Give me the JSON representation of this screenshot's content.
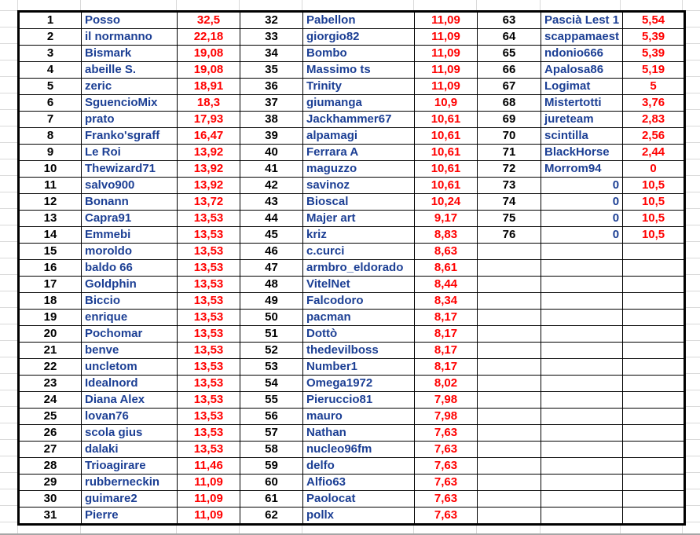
{
  "colors": {
    "name": "#1c3f94",
    "score": "#ff0000",
    "rank": "#000000"
  },
  "columns": [
    {
      "rows": [
        [
          "1",
          "Posso",
          "32,5"
        ],
        [
          "2",
          "il normanno",
          "22,18"
        ],
        [
          "3",
          "Bismark",
          "19,08"
        ],
        [
          "4",
          "abeille S.",
          "19,08"
        ],
        [
          "5",
          "zeric",
          "18,91"
        ],
        [
          "6",
          "SguencioMix",
          "18,3"
        ],
        [
          "7",
          "prato",
          "17,93"
        ],
        [
          "8",
          "Franko'sgraff",
          "16,47"
        ],
        [
          "9",
          "Le Roi",
          "13,92"
        ],
        [
          "10",
          "Thewizard71",
          "13,92"
        ],
        [
          "11",
          "salvo900",
          "13,92"
        ],
        [
          "12",
          "Bonann",
          "13,72"
        ],
        [
          "13",
          "Capra91",
          "13,53"
        ],
        [
          "14",
          "Emmebi",
          "13,53"
        ],
        [
          "15",
          "moroldo",
          "13,53"
        ],
        [
          "16",
          "baldo 66",
          "13,53"
        ],
        [
          "17",
          "Goldphin",
          "13,53"
        ],
        [
          "18",
          "Biccio",
          "13,53"
        ],
        [
          "19",
          "enrique",
          "13,53"
        ],
        [
          "20",
          "Pochomar",
          "13,53"
        ],
        [
          "21",
          "benve",
          "13,53"
        ],
        [
          "22",
          "uncletom",
          "13,53"
        ],
        [
          "23",
          "Idealnord",
          "13,53"
        ],
        [
          "24",
          "Diana Alex",
          "13,53"
        ],
        [
          "25",
          "lovan76",
          "13,53"
        ],
        [
          "26",
          "scola gius",
          "13,53"
        ],
        [
          "27",
          "dalaki",
          "13,53"
        ],
        [
          "28",
          "Trioagirare",
          "11,46"
        ],
        [
          "29",
          "rubberneckin",
          "11,09"
        ],
        [
          "30",
          "guimare2",
          "11,09"
        ],
        [
          "31",
          "Pierre",
          "11,09"
        ]
      ]
    },
    {
      "rows": [
        [
          "32",
          "Pabellon",
          "11,09"
        ],
        [
          "33",
          "giorgio82",
          "11,09"
        ],
        [
          "34",
          "Bombo",
          "11,09"
        ],
        [
          "35",
          "Massimo ts",
          "11,09"
        ],
        [
          "36",
          "Trinity",
          "11,09"
        ],
        [
          "37",
          "giumanga",
          "10,9"
        ],
        [
          "38",
          "Jackhammer67",
          "10,61"
        ],
        [
          "39",
          "alpamagi",
          "10,61"
        ],
        [
          "40",
          "Ferrara A",
          "10,61"
        ],
        [
          "41",
          "maguzzo",
          "10,61"
        ],
        [
          "42",
          "savinoz",
          "10,61"
        ],
        [
          "43",
          "Bioscal",
          "10,24"
        ],
        [
          "44",
          "Majer art",
          "9,17"
        ],
        [
          "45",
          "kriz",
          "8,83"
        ],
        [
          "46",
          "c.curci",
          "8,63"
        ],
        [
          "47",
          "armbro_eldorado",
          "8,61"
        ],
        [
          "48",
          "VitelNet",
          "8,44"
        ],
        [
          "49",
          "Falcodoro",
          "8,34"
        ],
        [
          "50",
          "pacman",
          "8,17"
        ],
        [
          "51",
          "Dottò",
          "8,17"
        ],
        [
          "52",
          "thedevilboss",
          "8,17"
        ],
        [
          "53",
          "Number1",
          "8,17"
        ],
        [
          "54",
          "Omega1972",
          "8,02"
        ],
        [
          "55",
          "Pieruccio81",
          "7,98"
        ],
        [
          "56",
          "mauro",
          "7,98"
        ],
        [
          "57",
          "Nathan",
          "7,63"
        ],
        [
          "58",
          "nucleo96fm",
          "7,63"
        ],
        [
          "59",
          "delfo",
          "7,63"
        ],
        [
          "60",
          "Alfio63",
          "7,63"
        ],
        [
          "61",
          "Paolocat",
          "7,63"
        ],
        [
          "62",
          "pollx",
          "7,63"
        ]
      ]
    },
    {
      "rows": [
        [
          "63",
          "Pascià Lest 1",
          "5,54"
        ],
        [
          "64",
          "scappamaest",
          "5,39"
        ],
        [
          "65",
          "ndonio666",
          "5,39"
        ],
        [
          "66",
          "Apalosa86",
          "5,19"
        ],
        [
          "67",
          "Logimat",
          "5"
        ],
        [
          "68",
          "Mistertotti",
          "3,76"
        ],
        [
          "69",
          "jureteam",
          "2,83"
        ],
        [
          "70",
          "scintilla",
          "2,56"
        ],
        [
          "71",
          "BlackHorse",
          "2,44"
        ],
        [
          "72",
          "Morrom94",
          "0"
        ],
        [
          "73",
          "0",
          "10,5"
        ],
        [
          "74",
          "0",
          "10,5"
        ],
        [
          "75",
          "0",
          "10,5"
        ],
        [
          "76",
          "0",
          "10,5"
        ]
      ]
    }
  ]
}
